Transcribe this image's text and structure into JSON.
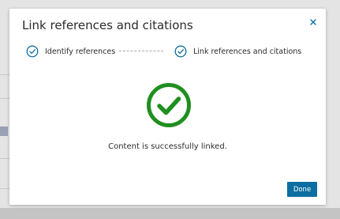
{
  "dialog": {
    "title": "Link references and citations",
    "close_icon": "close-icon"
  },
  "stepper": {
    "steps": [
      {
        "label": "Identify references",
        "status": "complete",
        "icon": "check-circle-icon"
      },
      {
        "label": "Link references and citations",
        "status": "complete",
        "icon": "check-circle-icon"
      }
    ]
  },
  "result": {
    "icon": "success-check-icon",
    "message": "Content is successfully linked."
  },
  "footer": {
    "done_label": "Done"
  },
  "colors": {
    "accent": "#0c6ea1",
    "success": "#1f8f1f",
    "step_icon": "#0c6ea1"
  }
}
